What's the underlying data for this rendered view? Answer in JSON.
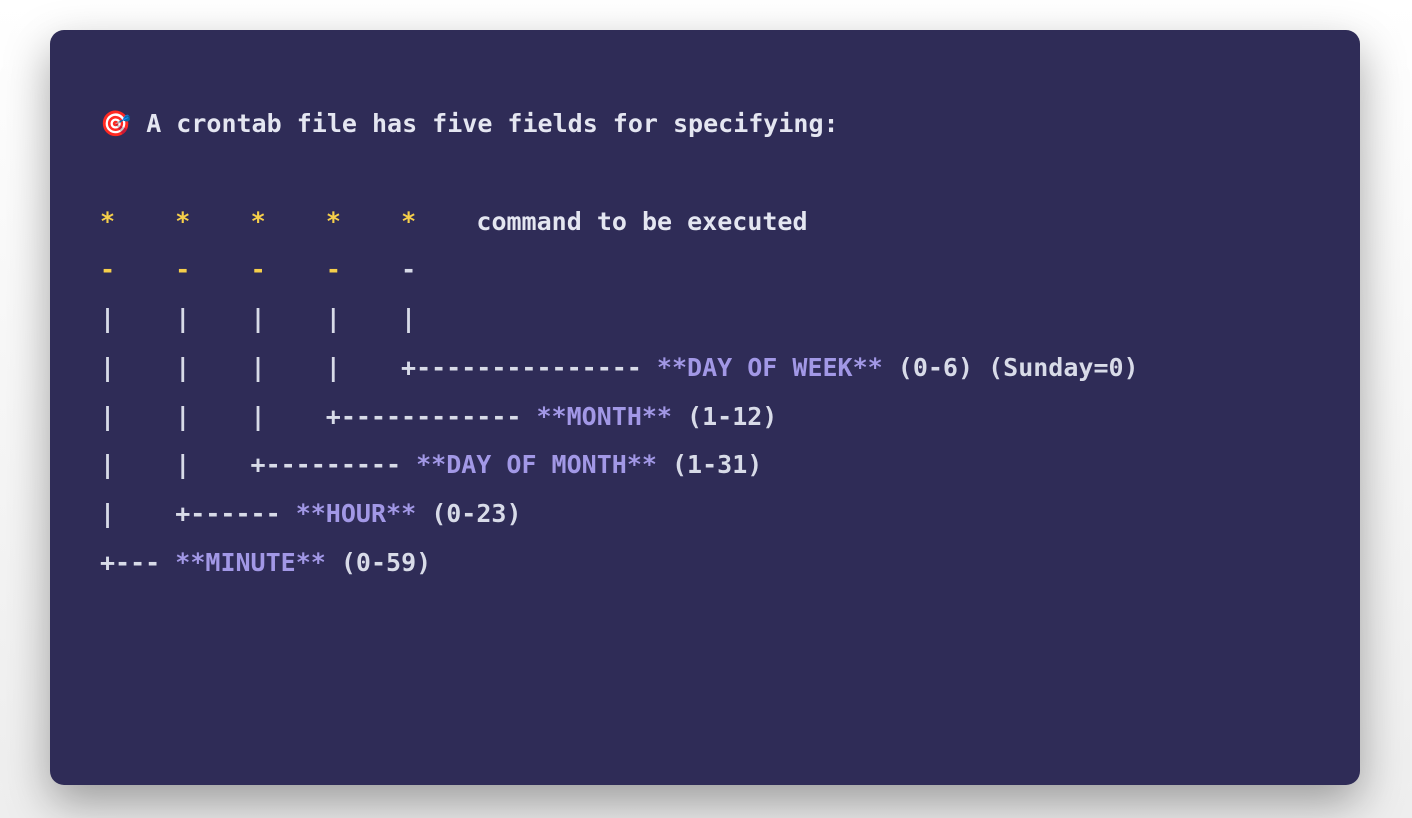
{
  "icon": "🎯",
  "title": "A crontab file has five fields for specifying:",
  "star": "*",
  "cmd_label": "command to be executed",
  "dash": "-",
  "fields": {
    "dow": {
      "stars": "**",
      "name": "DAY OF WEEK",
      "stars2": "**",
      "range": "(0-6) (Sunday=0)"
    },
    "month": {
      "stars": "**",
      "name": "MONTH",
      "stars2": "**",
      "range": "(1-12)"
    },
    "dom": {
      "stars": "**",
      "name": "DAY OF MONTH",
      "stars2": "**",
      "range": "(1-31)"
    },
    "hour": {
      "stars": "**",
      "name": "HOUR",
      "stars2": "**",
      "range": "(0-23)"
    },
    "min": {
      "stars": "**",
      "name": "MINUTE",
      "stars2": "**",
      "range": "(0-59)"
    }
  }
}
